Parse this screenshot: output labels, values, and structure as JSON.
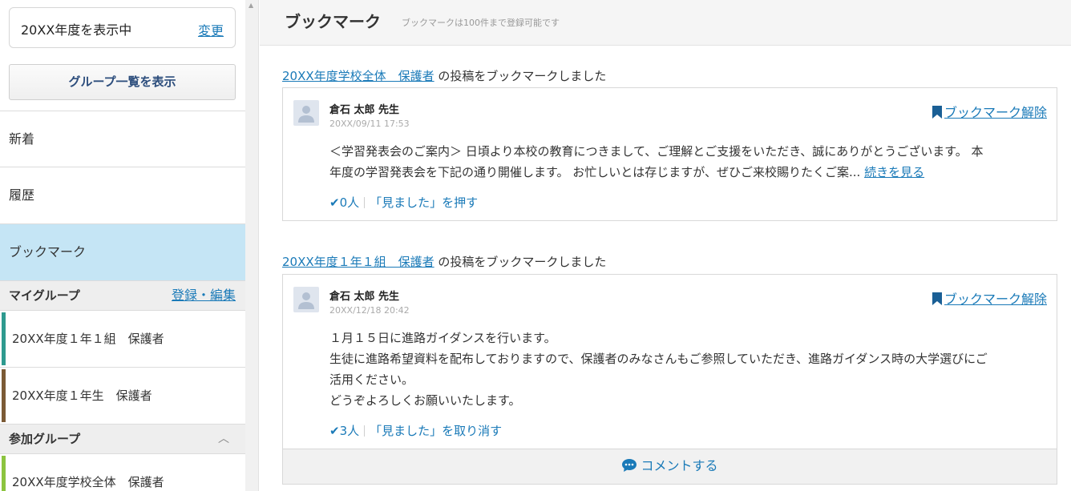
{
  "sidebar": {
    "year_text": "20XX年度を表示中",
    "year_change": "変更",
    "group_list_button": "グループ一覧を表示",
    "nav": {
      "new": "新着",
      "history": "履歴",
      "bookmark": "ブックマーク"
    },
    "mygroup": {
      "title": "マイグループ",
      "edit": "登録・編集",
      "items": [
        {
          "label": "20XX年度１年１組　保護者",
          "color": "#2e9a8f"
        },
        {
          "label": "20XX年度１年生　保護者",
          "color": "#7b5a35"
        }
      ]
    },
    "joined": {
      "title": "参加グループ",
      "items": [
        {
          "label": "20XX年度学校全体　保護者",
          "color": "#8cc43f"
        }
      ]
    }
  },
  "main": {
    "title": "ブックマーク",
    "note": "ブックマークは100件まで登録可能です",
    "posts": [
      {
        "group_link": "20XX年度学校全体　保護者",
        "caption_suffix": " の投稿をブックマークしました",
        "author": "倉石 太郎 先生",
        "date": "20XX/09/11 17:53",
        "bookmark_remove": "ブックマーク解除",
        "body_line1": "＜学習発表会のご案内＞ 日頃より本校の教育につきまして、ご理解とご支援をいただき、誠にありがとうございます。 本",
        "body_line2": "年度の学習発表会を下記の通り開催します。 お忙しいとは存じますが、ぜひご来校賜りたくご案...",
        "read_more": "続きを見る",
        "seen_count": "0人",
        "seen_action": "「見ました」を押す"
      },
      {
        "group_link": "20XX年度１年１組　保護者",
        "caption_suffix": " の投稿をブックマークしました",
        "author": "倉石 太郎 先生",
        "date": "20XX/12/18 20:42",
        "bookmark_remove": "ブックマーク解除",
        "body_lines": [
          "１月１５日に進路ガイダンスを行います。",
          "生徒に進路希望資料を配布しておりますので、保護者のみなさんもご参照していただき、進路ガイダンス時の大学選びにご",
          "活用ください。",
          "どうぞよろしくお願いいたします。"
        ],
        "seen_count": "3人",
        "seen_action": "「見ました」を取り消す",
        "comment": "コメントする"
      }
    ]
  },
  "colors": {
    "accent": "#1a7ab8",
    "active_nav": "#c5e5f5"
  }
}
